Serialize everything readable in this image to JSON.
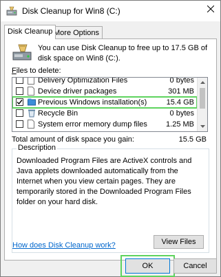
{
  "window": {
    "title": "Disk Cleanup for Win8 (C:)"
  },
  "tabs": [
    {
      "label": "Disk Cleanup",
      "active": true
    },
    {
      "label": "More Options",
      "active": false
    }
  ],
  "intro": {
    "text": "You can use Disk Cleanup to free up to 17.5 GB of disk space on Win8 (C:)."
  },
  "files": {
    "label": "Files to delete:",
    "items": [
      {
        "name": "Delivery Optimization Files",
        "size": "0 bytes",
        "checked": false
      },
      {
        "name": "Device driver packages",
        "size": "301 MB",
        "checked": false
      },
      {
        "name": "Previous Windows installation(s)",
        "size": "15.4 GB",
        "checked": true,
        "highlighted": true
      },
      {
        "name": "Recycle Bin",
        "size": "0 bytes",
        "checked": false
      },
      {
        "name": "System error memory dump files",
        "size": "1.25 MB",
        "checked": false
      }
    ]
  },
  "total": {
    "label": "Total amount of disk space you gain:",
    "value": "15.5 GB"
  },
  "description": {
    "title": "Description",
    "text": "Downloaded Program Files are ActiveX controls and Java applets downloaded automatically from the Internet when you view certain pages. They are temporarily stored in the Downloaded Program Files folder on your hard disk.",
    "view_files_label": "View Files"
  },
  "help_link": "How does Disk Cleanup work?",
  "buttons": {
    "ok": "OK",
    "cancel": "Cancel"
  },
  "colors": {
    "highlight": "#5dd35d",
    "link": "#0066cc",
    "accent": "#0078d7"
  },
  "icons": {
    "app": "disk-cleanup-icon",
    "close": "close-icon",
    "intro": "drive-icon",
    "file": "file-icon",
    "check": "check-icon"
  }
}
